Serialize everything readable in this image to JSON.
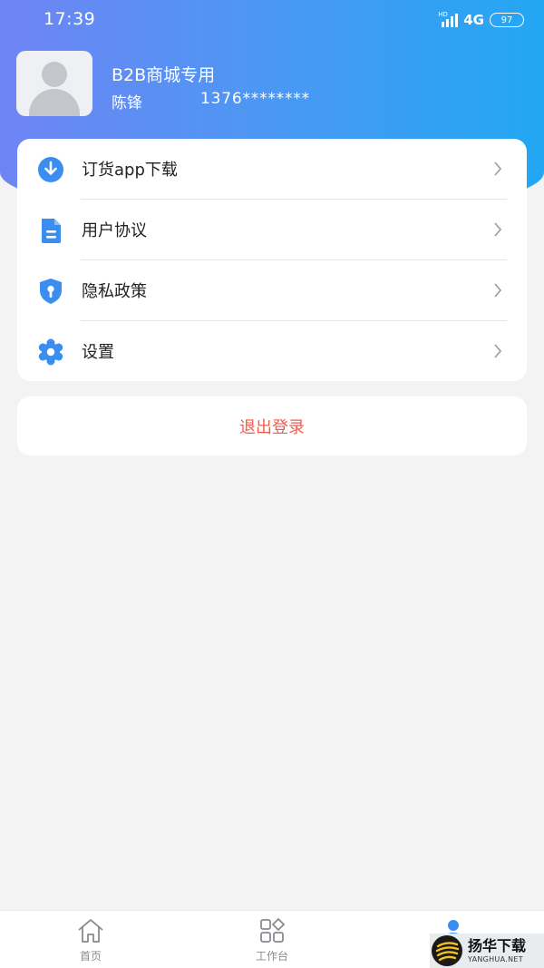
{
  "status_bar": {
    "time": "17:39",
    "hd": "HD",
    "network": "4G",
    "battery": "97"
  },
  "profile": {
    "store_name": "B2B商城专用",
    "user_name": "陈锋",
    "phone": "1376********"
  },
  "menu": {
    "items": [
      {
        "label": "订货app下载",
        "icon": "download-circle-icon"
      },
      {
        "label": "用户协议",
        "icon": "document-icon"
      },
      {
        "label": "隐私政策",
        "icon": "shield-icon"
      },
      {
        "label": "设置",
        "icon": "gear-icon"
      }
    ]
  },
  "logout": {
    "label": "退出登录"
  },
  "tabbar": {
    "tabs": [
      {
        "label": "首页",
        "icon": "home-icon"
      },
      {
        "label": "工作台",
        "icon": "workbench-grid-icon"
      },
      {
        "label": "",
        "icon": "user-icon"
      }
    ]
  },
  "watermark": {
    "cn": "扬华下载",
    "en": "YANGHUA.NET"
  },
  "colors": {
    "accent": "#3a8ef0",
    "header_gradient_start": "#6f84f5",
    "header_gradient_end": "#22a7f3",
    "logout_text": "#f25b4e",
    "icon_blue": "#3a8ef0"
  }
}
